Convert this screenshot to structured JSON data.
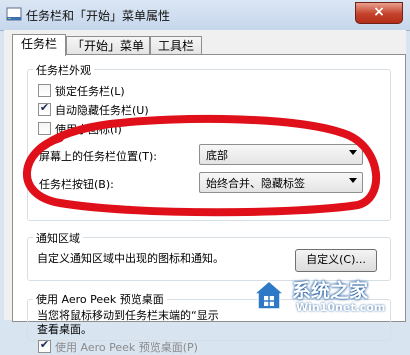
{
  "window": {
    "title": "任务栏和「开始」菜单属性",
    "close_label": "×"
  },
  "tabs": [
    {
      "label": "任务栏",
      "active": true
    },
    {
      "label": "「开始」菜单",
      "active": false
    },
    {
      "label": "工具栏",
      "active": false
    }
  ],
  "appearance": {
    "group_label": "任务栏外观",
    "lock_label": "锁定任务栏(L)",
    "lock_checked": false,
    "autohide_label": "自动隐藏任务栏(U)",
    "autohide_checked": true,
    "small_icons_label": "使用小图标(I)",
    "small_icons_checked": false,
    "location_label": "屏幕上的任务栏位置(T):",
    "location_value": "底部",
    "buttons_label": "任务栏按钮(B):",
    "buttons_value": "始终合并、隐藏标签"
  },
  "notification": {
    "group_label": "通知区域",
    "description": "自定义通知区域中出现的图标和通知。",
    "customize_label": "自定义(C)..."
  },
  "aero_peek": {
    "group_label": "使用 Aero Peek 预览桌面",
    "description_line1": "当您将鼠标移动到任务栏末端的“显示",
    "description_line2": "查看桌面。",
    "checkbox_label": "使用 Aero Peek 预览桌面(P)",
    "checkbox_checked": true
  },
  "watermark": {
    "title": "系统之家",
    "url": "Win10net.com"
  },
  "colors": {
    "annotation_red": "#e0101a",
    "window_frame": "#d9e4f1"
  }
}
